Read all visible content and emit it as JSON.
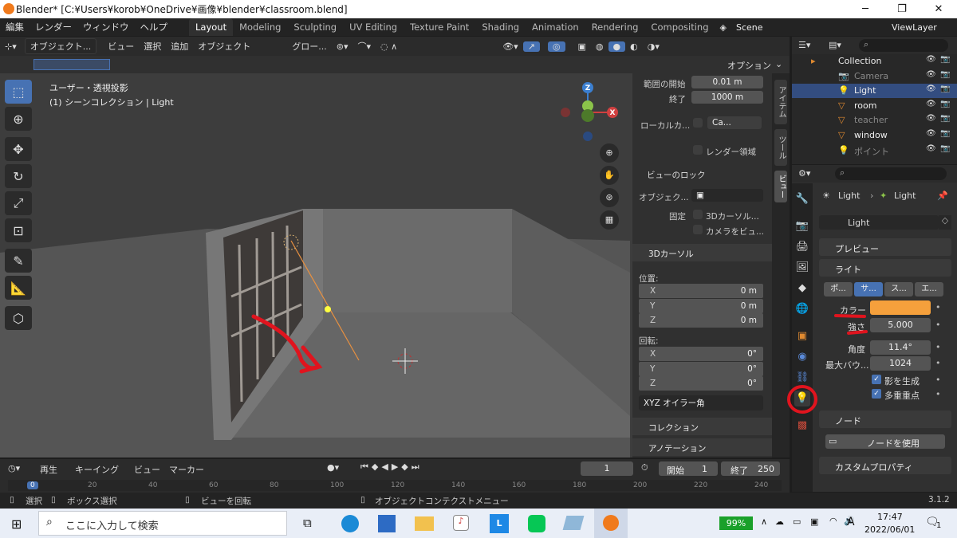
{
  "window": {
    "title": "Blender* [C:¥Users¥korob¥OneDrive¥画像¥blender¥classroom.blend]",
    "minimize": "─",
    "maximize": "❐",
    "close": "✕"
  },
  "menubar": {
    "menus": [
      "編集",
      "レンダー",
      "ウィンドウ",
      "ヘルプ"
    ],
    "workspaces": [
      "Layout",
      "Modeling",
      "Sculpting",
      "UV Editing",
      "Texture Paint",
      "Shading",
      "Animation",
      "Rendering",
      "Compositing"
    ],
    "active_workspace": "Layout",
    "scene": "Scene",
    "viewlayer": "ViewLayer"
  },
  "viewport_header": {
    "mode": "オブジェクト...",
    "menus": [
      "ビュー",
      "選択",
      "追加",
      "オブジェクト"
    ],
    "orientation": "グロー...",
    "options": "オプション"
  },
  "viewport": {
    "view_name": "ユーザー・透視投影",
    "collection_info": "(1) シーンコレクション | Light",
    "gizmo": {
      "z": "Z",
      "x": "X"
    }
  },
  "npanel": {
    "clip_start_label": "範囲の開始",
    "clip_start": "0.01 m",
    "clip_end_label": "終了",
    "clip_end": "1000 m",
    "local_camera_label": "ローカルカ...",
    "local_camera_value": "Ca...",
    "render_region": "レンダー領域",
    "view_lock_header": "ビューのロック",
    "lock_object_label": "オブジェク...",
    "lock_label": "固定",
    "lock_3d_cursor": "3Dカーソル...",
    "lock_camera": "カメラをビュ...",
    "cursor_header": "3Dカーソル",
    "location_label": "位置:",
    "location": [
      {
        "axis": "X",
        "value": "0 m"
      },
      {
        "axis": "Y",
        "value": "0 m"
      },
      {
        "axis": "Z",
        "value": "0 m"
      }
    ],
    "rotation_label": "回転:",
    "rotation": [
      {
        "axis": "X",
        "value": "0°"
      },
      {
        "axis": "Y",
        "value": "0°"
      },
      {
        "axis": "Z",
        "value": "0°"
      }
    ],
    "rotation_mode": "XYZ オイラー角",
    "collection_header": "コレクション",
    "annotation_header": "アノテーション",
    "tabs": [
      "アイテム",
      "ツール",
      "ビュー"
    ]
  },
  "outliner": {
    "items": [
      {
        "name": "Collection",
        "type": "collection"
      },
      {
        "name": "Camera",
        "type": "camera"
      },
      {
        "name": "Light",
        "type": "light"
      },
      {
        "name": "room",
        "type": "mesh"
      },
      {
        "name": "teacher",
        "type": "mesh"
      },
      {
        "name": "window",
        "type": "mesh"
      },
      {
        "name": "ポイント",
        "type": "light"
      }
    ]
  },
  "properties": {
    "breadcrumb_object": "Light",
    "breadcrumb_data": "Light",
    "datablock": "Light",
    "preview_header": "プレビュー",
    "light_header": "ライト",
    "light_types": [
      "ポ...",
      "サ...",
      "ス...",
      "エ..."
    ],
    "active_light_type": "サ...",
    "color_label": "カラー",
    "color_value": "#f5a03c",
    "strength_label": "強さ",
    "strength": "5.000",
    "angle_label": "角度",
    "angle": "11.4°",
    "max_bounces_label": "最大バウ...",
    "max_bounces": "1024",
    "cast_shadow": "影を生成",
    "multiple_importance": "多重重点",
    "nodes_header": "ノード",
    "use_nodes": "ノードを使用",
    "custom_props_header": "カスタムプロパティ"
  },
  "timeline": {
    "menus": [
      "再生",
      "キーイング",
      "ビュー",
      "マーカー"
    ],
    "current_frame": "1",
    "start_label": "開始",
    "start": "1",
    "end_label": "終了",
    "end": "250",
    "ruler_ticks": [
      "0",
      "20",
      "40",
      "60",
      "80",
      "100",
      "120",
      "140",
      "160",
      "180",
      "200",
      "220",
      "240"
    ]
  },
  "statusbar": {
    "select": "選択",
    "box_select": "ボックス選択",
    "rotate_view": "ビューを回転",
    "context_menu": "オブジェクトコンテクストメニュー",
    "version": "3.1.2"
  },
  "taskbar": {
    "search_placeholder": "ここに入力して検索",
    "battery": "99%",
    "ime": "A",
    "time": "17:47",
    "date": "2022/06/01",
    "notifications": "1"
  },
  "colors": {
    "accent": "#4772b3",
    "annotation_red": "#e0141e",
    "light_color": "#f5a03c"
  }
}
